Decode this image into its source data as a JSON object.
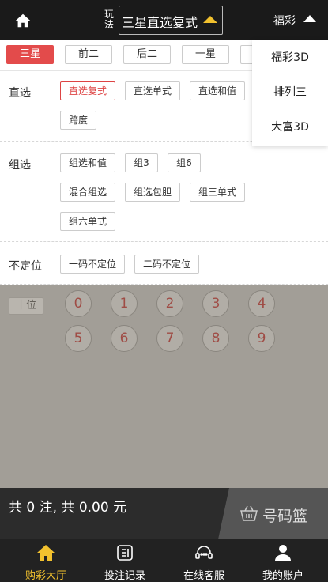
{
  "header": {
    "play_label_line1": "玩",
    "play_label_line2": "法",
    "play_selected": "三星直选复式",
    "lottery_name": "福彩"
  },
  "tabs": [
    {
      "label": "三星",
      "active": true
    },
    {
      "label": "前二",
      "active": false
    },
    {
      "label": "后二",
      "active": false
    },
    {
      "label": "一星",
      "active": false
    }
  ],
  "sections": {
    "direct": {
      "title": "直选",
      "options": [
        "直选复式",
        "直选单式",
        "直选和值",
        "跨度"
      ]
    },
    "group": {
      "title": "组选",
      "options": [
        "组选和值",
        "组3",
        "组6",
        "混合组选",
        "组选包胆",
        "组三单式",
        "组六单式"
      ]
    },
    "unfixed": {
      "title": "不定位",
      "options": [
        "一码不定位",
        "二码不定位"
      ]
    }
  },
  "balls": {
    "position_label": "十位",
    "numbers": [
      "0",
      "1",
      "2",
      "3",
      "4",
      "5",
      "6",
      "7",
      "8",
      "9"
    ]
  },
  "summary": {
    "text": "共 0 注, 共 0.00 元",
    "basket_label": "号码篮"
  },
  "dropdown": {
    "items": [
      "福彩3D",
      "排列三",
      "大富3D"
    ]
  },
  "bottom_nav": [
    {
      "label": "购彩大厅",
      "icon": "home-icon",
      "active": true
    },
    {
      "label": "投注记录",
      "icon": "receipt-icon",
      "active": false
    },
    {
      "label": "在线客服",
      "icon": "headset-icon",
      "active": false
    },
    {
      "label": "我的账户",
      "icon": "user-icon",
      "active": false
    }
  ],
  "colors": {
    "accent_red": "#e34b4b",
    "nav_active": "#f2c12e",
    "header_bg": "#1a1a1a"
  }
}
